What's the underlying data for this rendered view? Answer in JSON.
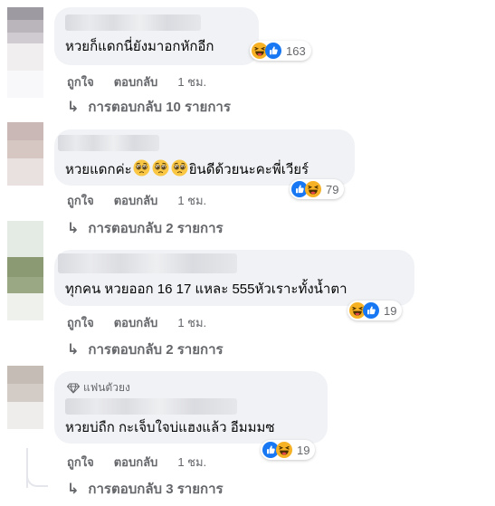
{
  "comments": [
    {
      "text": "หวยก็แดกนี่ยังมาอกหักอีก",
      "reaction_count": "163",
      "reactions": [
        "haha-icon",
        "like-icon"
      ],
      "like_label": "ถูกใจ",
      "reply_label": "ตอบกลับ",
      "time": "1 ชม.",
      "replies_label": "การตอบกลับ 10 รายการ"
    },
    {
      "text_before": "หวยแดกค่ะ",
      "text_after": "ยินดีด้วยนะคะพี่เวียร์",
      "inline_emoji": "pleading-face-emoji",
      "reaction_count": "79",
      "reactions": [
        "like-icon",
        "haha-icon"
      ],
      "like_label": "ถูกใจ",
      "reply_label": "ตอบกลับ",
      "time": "1 ชม.",
      "replies_label": "การตอบกลับ 2 รายการ"
    },
    {
      "text": "ทุกคน หวยออก 16 17 แหละ 555หัวเราะทั้งน้ำตา",
      "reaction_count": "19",
      "reactions": [
        "haha-icon",
        "like-icon"
      ],
      "like_label": "ถูกใจ",
      "reply_label": "ตอบกลับ",
      "time": "1 ชม.",
      "replies_label": "การตอบกลับ 2 รายการ"
    },
    {
      "badge": "แฟนตัวยง",
      "text": "หวยบ่ถืก กะเจ็บใจบ่แฮงแล้ว อีมมมซ",
      "reaction_count": "19",
      "reactions": [
        "like-icon",
        "haha-icon"
      ],
      "like_label": "ถูกใจ",
      "reply_label": "ตอบกลับ",
      "time": "1 ชม.",
      "replies_label": "การตอบกลับ 3 รายการ"
    }
  ],
  "colors": {
    "bubble": "#f0f2f5",
    "secondary_text": "#65676b",
    "like_blue": "#1877f2",
    "haha_yellow": "#f7b125"
  }
}
